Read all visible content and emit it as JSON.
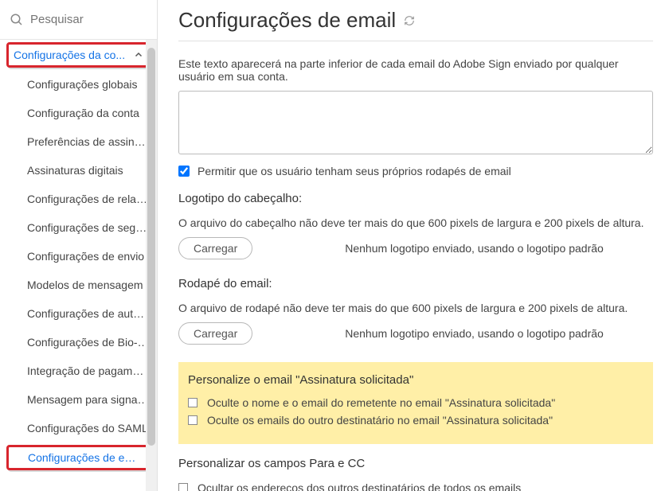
{
  "search": {
    "placeholder": "Pesquisar"
  },
  "sidebar": {
    "section_label": "Configurações da co...",
    "items": [
      {
        "label": "Configurações globais"
      },
      {
        "label": "Configuração da conta"
      },
      {
        "label": "Preferências de assinatura"
      },
      {
        "label": "Assinaturas digitais"
      },
      {
        "label": "Configurações de relatório"
      },
      {
        "label": "Configurações de segura..."
      },
      {
        "label": "Configurações de envio"
      },
      {
        "label": "Modelos de mensagem"
      },
      {
        "label": "Configurações de autenti..."
      },
      {
        "label": "Configurações de Bio-Ph..."
      },
      {
        "label": "Integração de pagamento"
      },
      {
        "label": "Mensagem para signatário"
      },
      {
        "label": "Configurações do SAML"
      },
      {
        "label": "Configurações de email"
      }
    ]
  },
  "main": {
    "title": "Configurações de email",
    "intro": "Este texto aparecerá na parte inferior de cada email do Adobe Sign enviado por qualquer usuário em sua conta.",
    "allow_user_footers_label": "Permitir que os usuário tenham seus próprios rodapés de email",
    "header_logo": {
      "heading": "Logotipo do cabeçalho:",
      "note": "O arquivo do cabeçalho não deve ter mais do que 600 pixels de largura e 200 pixels de altura.",
      "upload_label": "Carregar",
      "status": "Nenhum logotipo enviado, usando o logotipo padrão"
    },
    "footer_logo": {
      "heading": "Rodapé do email:",
      "note": "O arquivo de rodapé não deve ter mais do que 600 pixels de largura e 200 pixels de altura.",
      "upload_label": "Carregar",
      "status": "Nenhum logotipo enviado, usando o logotipo padrão"
    },
    "sig_requested": {
      "heading": "Personalize o email \"Assinatura solicitada\"",
      "opt1": "Oculte o nome e o email do remetente no email \"Assinatura solicitada\"",
      "opt2": "Oculte os emails do outro destinatário no email \"Assinatura solicitada\""
    },
    "to_cc": {
      "heading": "Personalizar os campos Para e CC",
      "opt1": "Ocultar os endereços dos outros destinatários de todos os emails"
    }
  }
}
